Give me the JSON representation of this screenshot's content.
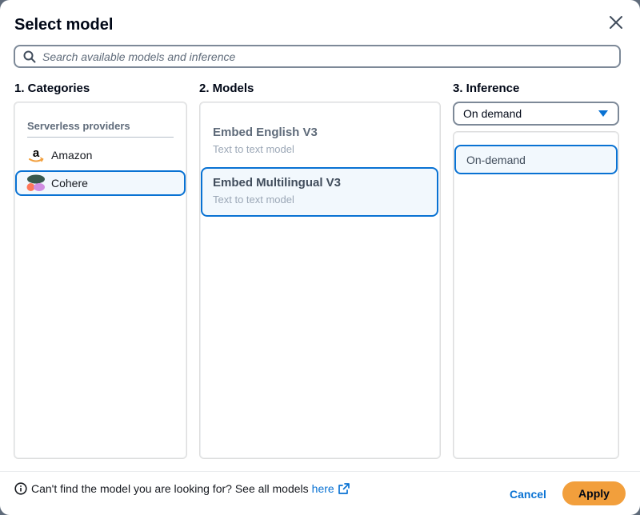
{
  "dialog": {
    "title": "Select model",
    "close_icon": "close-icon"
  },
  "search": {
    "placeholder": "Search available models and inference",
    "value": "",
    "icon": "search-icon"
  },
  "categories": {
    "heading": "1. Categories",
    "group_label": "Serverless providers",
    "providers": [
      {
        "label": "Amazon",
        "icon": "amazon-logo-icon",
        "selected": false
      },
      {
        "label": "Cohere",
        "icon": "cohere-logo-icon",
        "selected": true
      }
    ]
  },
  "models": {
    "heading": "2. Models",
    "items": [
      {
        "name": "Embed English V3",
        "subtitle": "Text to text model",
        "selected": false
      },
      {
        "name": "Embed Multilingual V3",
        "subtitle": "Text to text model",
        "selected": true
      }
    ]
  },
  "inference": {
    "heading": "3. Inference",
    "selected_value": "On demand",
    "items": [
      {
        "label": "On-demand",
        "selected": true
      }
    ]
  },
  "footer": {
    "note": "Can't find the model you are looking for? See all models",
    "link_label": "here",
    "info_icon": "info-icon",
    "external_icon": "external-link-icon",
    "cancel_label": "Cancel",
    "apply_label": "Apply"
  },
  "colors": {
    "accent": "#0972d3",
    "apply": "#f29f3c",
    "selected_bg": "#f2f8fd"
  }
}
